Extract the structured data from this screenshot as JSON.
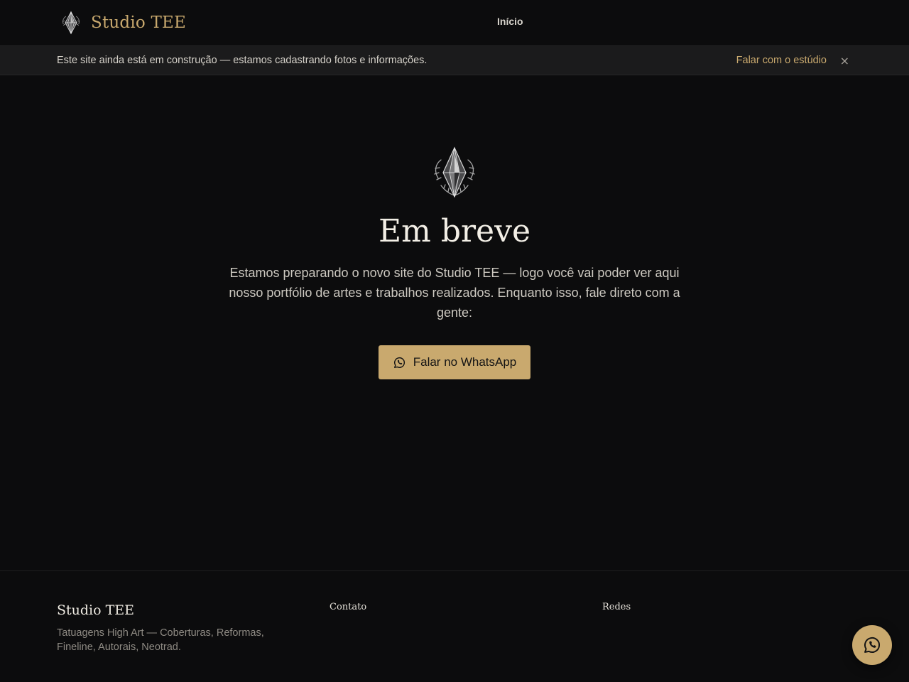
{
  "colors": {
    "background": "#0c0c0d",
    "accent": "#c9a96e",
    "notice_bg": "#1b1b1c"
  },
  "header": {
    "brand_name": "Studio TEE",
    "logo_icon": "crystal-emblem-icon",
    "nav": [
      {
        "label": "Início"
      }
    ]
  },
  "notice": {
    "text": "Este site ainda está em construção — estamos cadastrando fotos e informações.",
    "link_label": "Falar com o estúdio",
    "close_label": "×"
  },
  "hero": {
    "emblem_icon": "crystal-emblem-icon",
    "title": "Em breve",
    "text": "Estamos preparando o novo site do Studio TEE — logo você vai poder ver aqui nosso portfólio de artes e trabalhos realizados. Enquanto isso, fale direto com a gente:",
    "cta_label": "Falar no WhatsApp",
    "cta_icon": "whatsapp-icon"
  },
  "footer": {
    "brand_name": "Studio TEE",
    "tagline": "Tatuagens High Art — Coberturas, Reformas, Fineline, Autorais, Neotrad.",
    "contact_heading": "Contato",
    "social_heading": "Redes"
  },
  "fab": {
    "icon": "whatsapp-icon"
  }
}
